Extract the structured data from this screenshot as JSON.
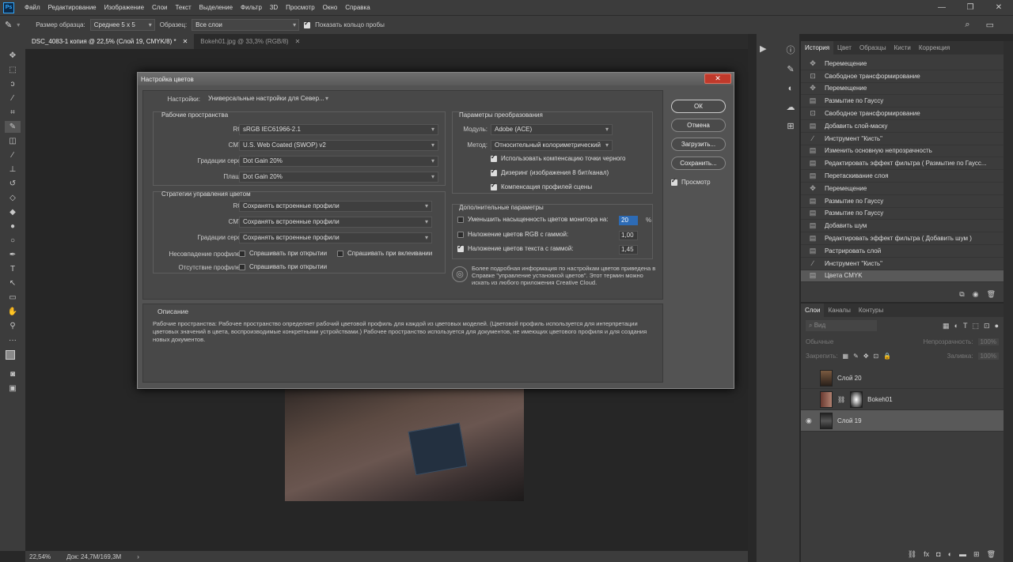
{
  "menubar": {
    "items": [
      "Файл",
      "Редактирование",
      "Изображение",
      "Слои",
      "Текст",
      "Выделение",
      "Фильтр",
      "3D",
      "Просмотр",
      "Окно",
      "Справка"
    ]
  },
  "options": {
    "sample_size_label": "Размер образца:",
    "sample_size_value": "Среднее 5 x 5",
    "sample_label": "Образец:",
    "sample_value": "Все слои",
    "ring_label": "Показать кольцо пробы"
  },
  "tabs": [
    {
      "label": "DSC_4083-1 копия @ 22,5% (Слой 19, CMYK/8) *"
    },
    {
      "label": "Bokeh01.jpg @ 33,3% (RGB/8)"
    }
  ],
  "status": {
    "zoom": "22,54%",
    "doc": "Док: 24,7M/169,3M"
  },
  "history": {
    "tabs": [
      "История",
      "Цвет",
      "Образцы",
      "Кисти",
      "Коррекция"
    ],
    "items": [
      "Перемещение",
      "Свободное трансформирование",
      "Перемещение",
      "Размытие по Гауссу",
      "Свободное трансформирование",
      "Добавить слой-маску",
      "Инструмент \"Кисть\"",
      "Изменить основную непрозрачность",
      "Редактировать эффект фильтра ( Размытие по Гаусс...",
      "Перетаскивание слоя",
      "Перемещение",
      "Размытие по Гауссу",
      "Размытие по Гауссу",
      "Добавить шум",
      "Редактировать эффект фильтра ( Добавить шум )",
      "Растрировать слой",
      "Инструмент \"Кисть\"",
      "Цвета CMYK"
    ]
  },
  "layers": {
    "tabs": [
      "Слои",
      "Каналы",
      "Контуры"
    ],
    "search_placeholder": "Вид",
    "blend_mode": "Обычные",
    "opacity_label": "Непрозрачность:",
    "opacity_value": "100%",
    "lock_label": "Закрепить:",
    "fill_label": "Заливка:",
    "fill_value": "100%",
    "items": [
      {
        "name": "Слой 20"
      },
      {
        "name": "Bokeh01"
      },
      {
        "name": "Слой 19"
      }
    ]
  },
  "dialog": {
    "title": "Настройка цветов",
    "settings_label": "Настройки:",
    "settings_value": "Универсальные настройки для Север...",
    "workspaces": {
      "title": "Рабочие пространства",
      "rgb_label": "RGB:",
      "rgb_value": "sRGB IEC61966-2.1",
      "cmyk_label": "CMYK:",
      "cmyk_value": "U.S. Web Coated (SWOP) v2",
      "gray_label": "Градации серого:",
      "gray_value": "Dot Gain 20%",
      "spot_label": "Плашка:",
      "spot_value": "Dot Gain 20%"
    },
    "policies": {
      "title": "Стратегии управления цветом",
      "rgb_label": "RGB:",
      "rgb_value": "Сохранять встроенные профили",
      "cmyk_label": "CMYK:",
      "cmyk_value": "Сохранять встроенные профили",
      "gray_label": "Градации серого:",
      "gray_value": "Сохранять встроенные профили",
      "mismatch_label": "Несовпадение профилей:",
      "ask_open": "Спрашивать при открытии",
      "ask_paste": "Спрашивать при вклеивании",
      "missing_label": "Отсутствие профилей:",
      "ask_open2": "Спрашивать при открытии"
    },
    "conversion": {
      "title": "Параметры преобразования",
      "engine_label": "Модуль:",
      "engine_value": "Adobe (ACE)",
      "intent_label": "Метод:",
      "intent_value": "Относительный колориметрический",
      "bpc": "Использовать компенсацию точки черного",
      "dither": "Дизеринг (изображения 8 бит/канал)",
      "scene": "Компенсация профилей сцены"
    },
    "advanced": {
      "title": "Дополнительные параметры",
      "desat_label": "Уменьшить насыщенность цветов монитора на:",
      "desat_value": "20",
      "desat_unit": "%",
      "blend_rgb_label": "Наложение цветов RGB с гаммой:",
      "blend_rgb_value": "1,00",
      "blend_text_label": "Наложение цветов текста с гаммой:",
      "blend_text_value": "1,45"
    },
    "info": "Более подробная информация по настройкам цветов приведена в Справке \"управление установкой цветов\". Этот термин можно искать из любого приложения Creative Cloud.",
    "description_title": "Описание",
    "description": "Рабочие пространства: Рабочее пространство определяет рабочий цветовой профиль для каждой из цветовых моделей. (Цветовой профиль используется для интерпретации цветовых значений в цвета, воспроизводимые конкретными устройствами.) Рабочее пространство используется для документов, не имеющих цветового профиля и для создания новых документов.",
    "buttons": {
      "ok": "ОК",
      "cancel": "Отмена",
      "load": "Загрузить...",
      "save": "Сохранить...",
      "preview": "Просмотр"
    }
  },
  "colors": {
    "accent": "#31a8ff",
    "close": "#c0392b"
  }
}
